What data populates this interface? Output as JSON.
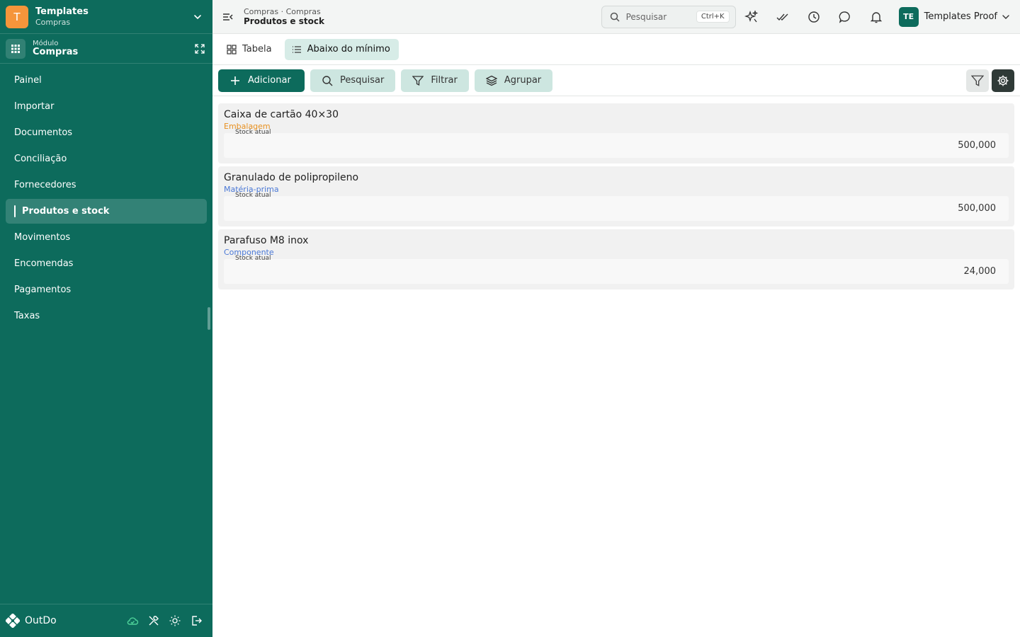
{
  "workspace": {
    "initial": "T",
    "title": "Templates",
    "subtitle": "Compras",
    "brand_color": "#f5953b"
  },
  "module": {
    "label": "Módulo",
    "name": "Compras"
  },
  "sidebar": {
    "bg_color": "#0d6b5c",
    "items": [
      {
        "label": "Painel"
      },
      {
        "label": "Importar"
      },
      {
        "label": "Documentos"
      },
      {
        "label": "Conciliação"
      },
      {
        "label": "Fornecedores"
      },
      {
        "label": "Produtos e stock",
        "active": true
      },
      {
        "label": "Movimentos"
      },
      {
        "label": "Encomendas"
      },
      {
        "label": "Pagamentos"
      },
      {
        "label": "Taxas"
      }
    ],
    "footer": {
      "brand": "OutDo",
      "icons": [
        "cloud-check-icon",
        "tools-icon",
        "sun-icon",
        "logout-icon"
      ]
    }
  },
  "header": {
    "breadcrumb": "Compras · Compras",
    "page_title": "Produtos e stock",
    "search": {
      "placeholder": "Pesquisar",
      "shortcut": "Ctrl+K"
    },
    "icons": [
      "sparkles-icon",
      "check-double-icon",
      "clock-icon",
      "chat-icon",
      "bell-icon"
    ],
    "user": {
      "initials": "TE",
      "name": "Templates Proof"
    }
  },
  "view_tabs": [
    {
      "label": "Tabela",
      "icon": "grid-icon",
      "active": false
    },
    {
      "label": "Abaixo do mínimo",
      "icon": "list-icon",
      "active": true
    }
  ],
  "toolbar": {
    "add_label": "Adicionar",
    "search_label": "Pesquisar",
    "filter_label": "Filtrar",
    "group_label": "Agrupar",
    "right_icons": [
      "filter-icon",
      "settings-icon"
    ]
  },
  "items": [
    {
      "name": "Caixa de cartão 40×30",
      "category": "Embalagem",
      "category_color": "#e8901f",
      "stock_label": "Stock atual",
      "stock": "500,000"
    },
    {
      "name": "Granulado de polipropileno",
      "category": "Matéria-prima",
      "category_color": "#4a78d6",
      "stock_label": "Stock atual",
      "stock": "500,000"
    },
    {
      "name": "Parafuso M8 inox",
      "category": "Componente",
      "category_color": "#4a78d6",
      "stock_label": "Stock atual",
      "stock": "24,000"
    }
  ]
}
